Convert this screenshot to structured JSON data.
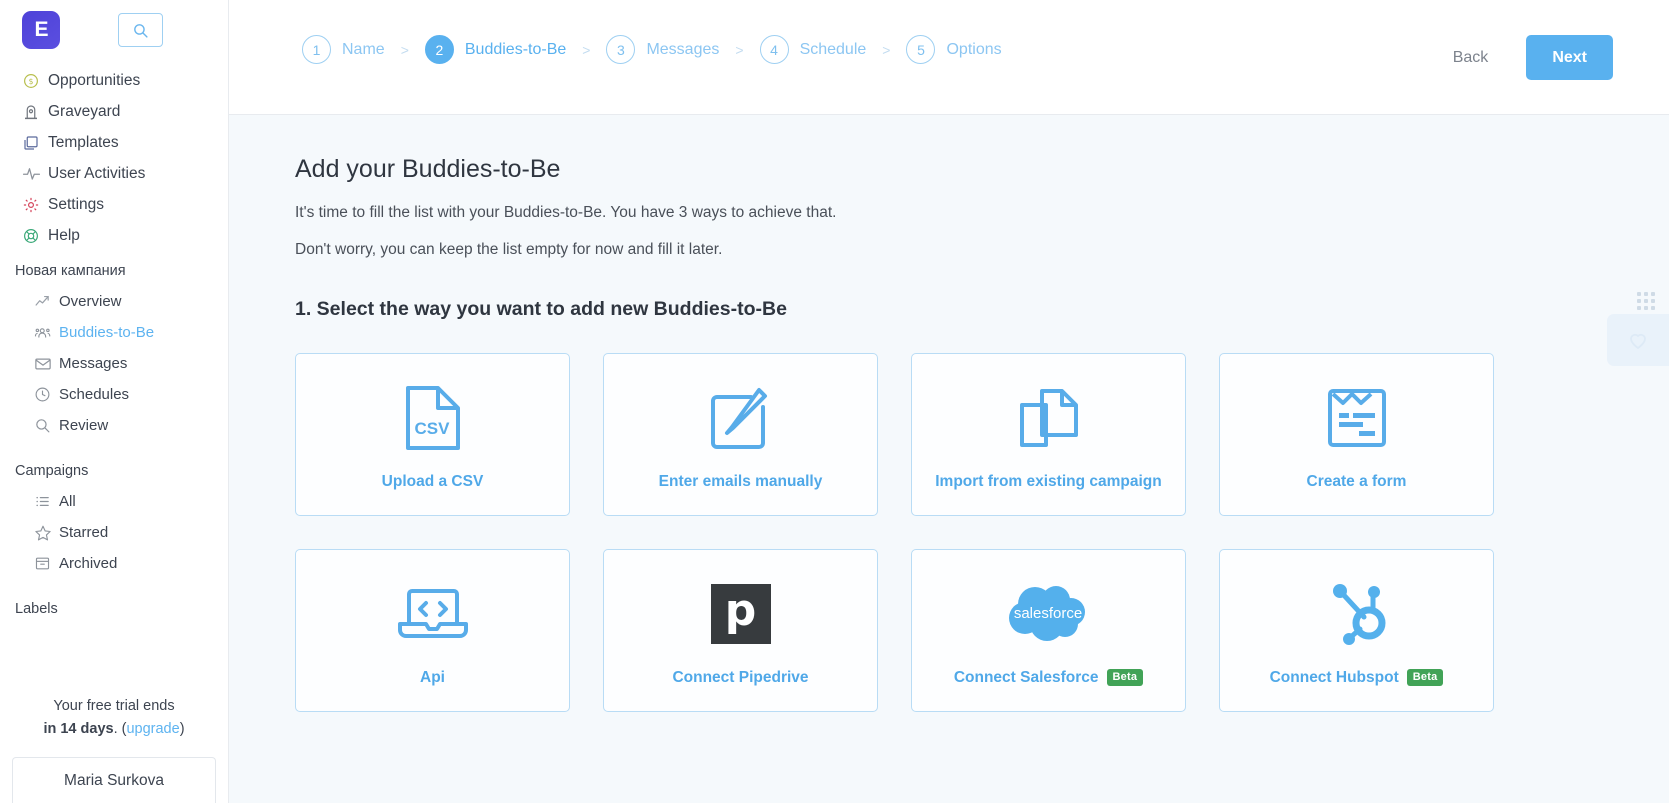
{
  "sidebar": {
    "logo_text": "E",
    "search_icon": "search-icon",
    "nav": [
      {
        "label": "Opportunities",
        "icon": "dollar-badge-icon"
      },
      {
        "label": "Graveyard",
        "icon": "tombstone-icon"
      },
      {
        "label": "Templates",
        "icon": "layers-icon"
      },
      {
        "label": "User Activities",
        "icon": "pulse-icon"
      },
      {
        "label": "Settings",
        "icon": "gear-icon"
      },
      {
        "label": "Help",
        "icon": "lifebuoy-icon"
      }
    ],
    "campaign_section_title": "Новая кампания",
    "campaign_nav": [
      {
        "label": "Overview",
        "icon": "chart-icon",
        "active": false
      },
      {
        "label": "Buddies-to-Be",
        "icon": "people-icon",
        "active": true
      },
      {
        "label": "Messages",
        "icon": "envelope-icon",
        "active": false
      },
      {
        "label": "Schedules",
        "icon": "clock-icon",
        "active": false
      },
      {
        "label": "Review",
        "icon": "search-icon",
        "active": false
      }
    ],
    "campaigns_section_title": "Campaigns",
    "campaigns_nav": [
      {
        "label": "All",
        "icon": "list-icon"
      },
      {
        "label": "Starred",
        "icon": "star-icon"
      },
      {
        "label": "Archived",
        "icon": "archive-box-icon"
      }
    ],
    "labels_section_title": "Labels",
    "trial": {
      "line1": "Your free trial ends",
      "bold": "in 14 days",
      "after_bold": ". (",
      "link": "upgrade",
      "close": ")"
    },
    "user_name": "Maria Surkova"
  },
  "topbar": {
    "steps": [
      {
        "num": "1",
        "label": "Name",
        "active": false
      },
      {
        "num": "2",
        "label": "Buddies-to-Be",
        "active": true
      },
      {
        "num": "3",
        "label": "Messages",
        "active": false
      },
      {
        "num": "4",
        "label": "Schedule",
        "active": false
      },
      {
        "num": "5",
        "label": "Options",
        "active": false
      }
    ],
    "separator": ">",
    "back_label": "Back",
    "next_label": "Next"
  },
  "main": {
    "title": "Add your Buddies-to-Be",
    "para1": "It's time to fill the list with your Buddies-to-Be. You have 3 ways to achieve that.",
    "para2": "Don't worry, you can keep the list empty for now and fill it later.",
    "section_heading": "1. Select the way you want to add new Buddies-to-Be",
    "cards": [
      {
        "label": "Upload a CSV",
        "icon": "csv-file-icon",
        "badge": ""
      },
      {
        "label": "Enter emails manually",
        "icon": "pencil-square-icon",
        "badge": ""
      },
      {
        "label": "Import from existing campaign",
        "icon": "copy-documents-icon",
        "badge": ""
      },
      {
        "label": "Create a form",
        "icon": "form-icon",
        "badge": ""
      },
      {
        "label": "Api",
        "icon": "laptop-code-icon",
        "badge": ""
      },
      {
        "label": "Connect Pipedrive",
        "icon": "pipedrive-logo-icon",
        "badge": ""
      },
      {
        "label": "Connect Salesforce",
        "icon": "salesforce-cloud-icon",
        "badge": "Beta"
      },
      {
        "label": "Connect Hubspot",
        "icon": "hubspot-sprocket-icon",
        "badge": "Beta"
      }
    ],
    "csv_icon_text": "CSV",
    "salesforce_word": "salesforce",
    "pipedrive_letter": "p"
  },
  "colors": {
    "accent": "#59b1ef",
    "card_border": "#b9dcf5",
    "beta_green": "#41a357",
    "content_bg": "#f5f9fc",
    "logo_purple": "#4e42d8"
  }
}
